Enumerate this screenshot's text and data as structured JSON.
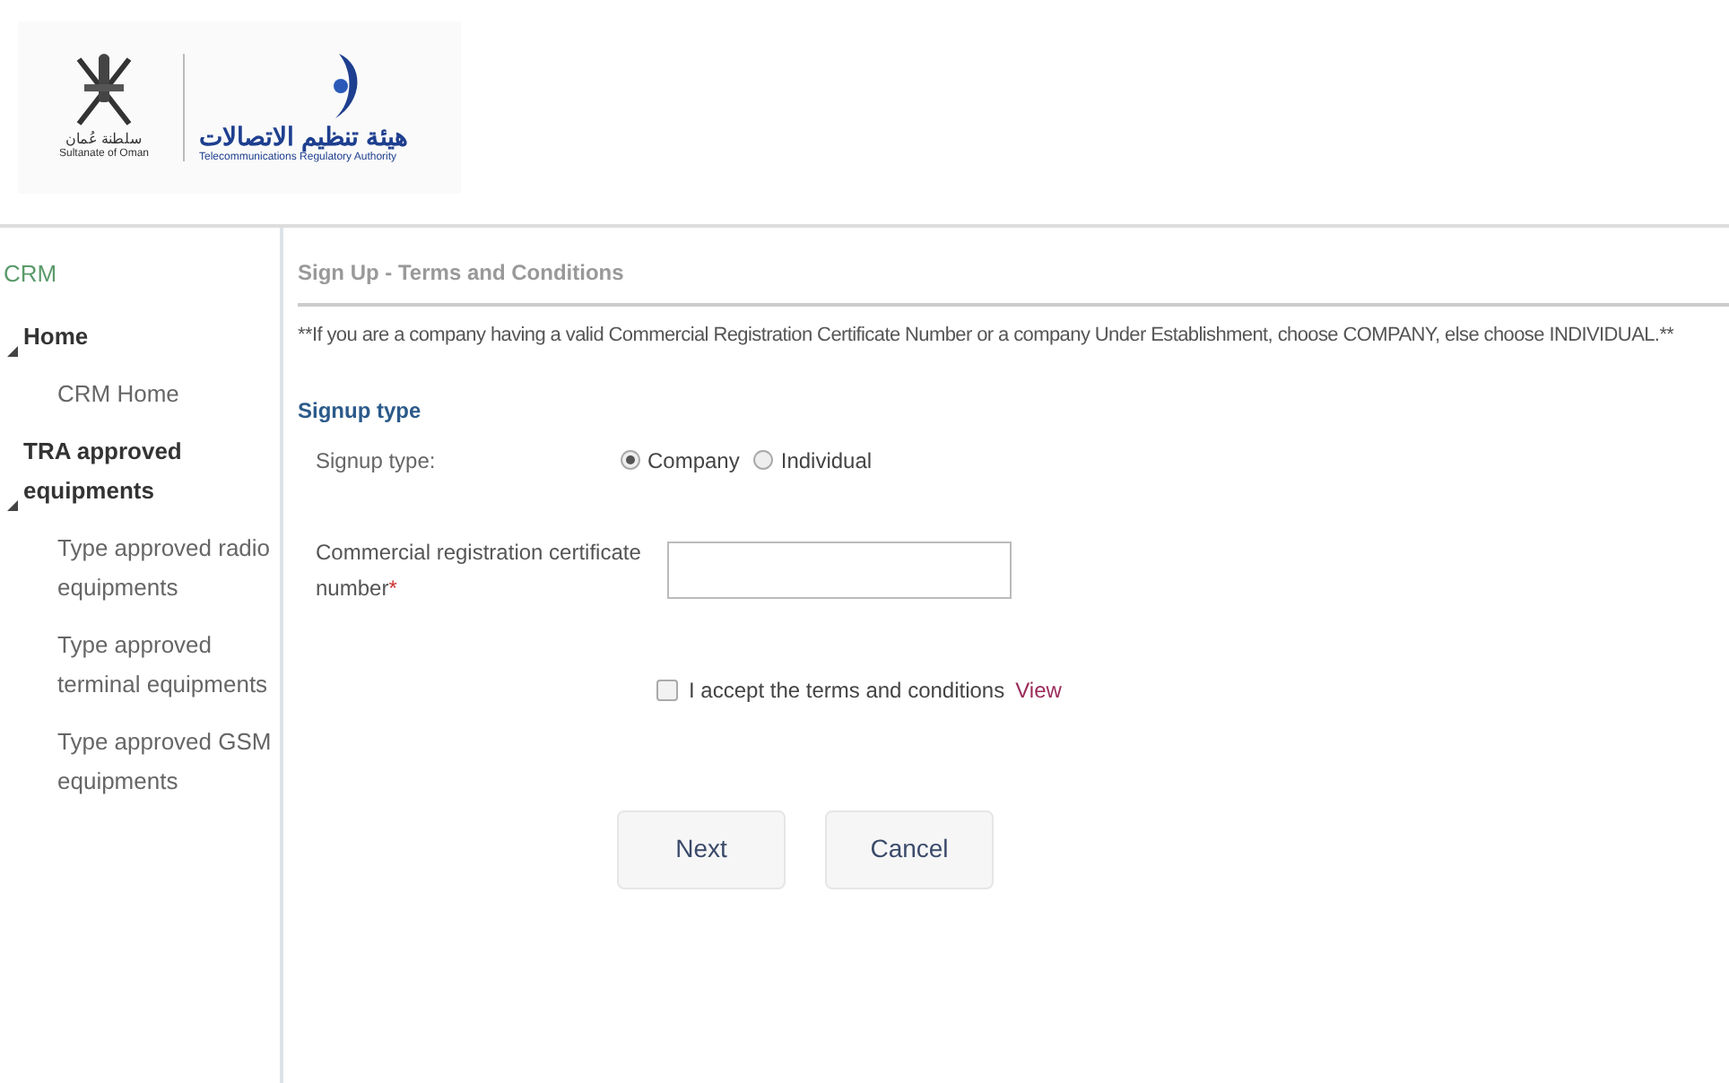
{
  "logo": {
    "emblem_caption_ar": "سلطنة عُمان",
    "emblem_caption_en": "Sultanate of Oman",
    "authority_ar": "هيئة تنظيم الاتصالات",
    "authority_en": "Telecommunications Regulatory Authority"
  },
  "sidebar": {
    "title": "CRM",
    "items": [
      {
        "label": "Home",
        "expanded": true,
        "children": [
          {
            "label": "CRM Home"
          }
        ]
      },
      {
        "label": "TRA approved equipments",
        "expanded": true,
        "children": [
          {
            "label": "Type approved radio equipments"
          },
          {
            "label": "Type approved terminal equipments"
          },
          {
            "label": "Type approved GSM equipments"
          }
        ]
      }
    ]
  },
  "page": {
    "title": "Sign Up - Terms and Conditions",
    "notice": "**If you are a company having a valid Commercial Registration Certificate Number or a company Under Establishment, choose COMPANY, else choose INDIVIDUAL.**",
    "section_title": "Signup type",
    "signup_type": {
      "label": "Signup type:",
      "options": [
        {
          "label": "Company",
          "selected": true
        },
        {
          "label": "Individual",
          "selected": false
        }
      ]
    },
    "cr_field": {
      "label": "Commercial registration certificate number",
      "required_mark": "*"
    },
    "terms": {
      "label": "I accept the terms and conditions",
      "checked": false,
      "link": "View"
    },
    "buttons": [
      "Next",
      "Cancel"
    ]
  }
}
